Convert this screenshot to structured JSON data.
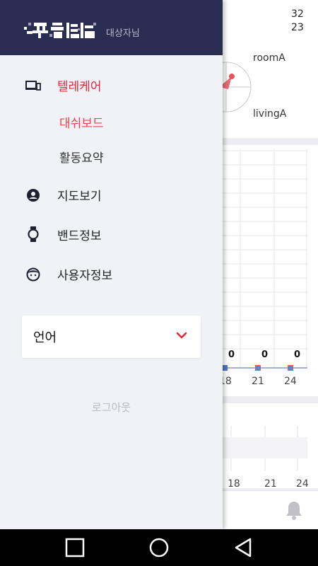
{
  "weather": {
    "icon": "sun-icon",
    "temp_high": "32",
    "temp_low": "23",
    "color": "#f04a2a"
  },
  "rooms": {
    "room_a": "roomA",
    "living_a": "livingA"
  },
  "chart": {
    "values": [
      "0",
      "0",
      "0"
    ],
    "x_labels": [
      "18",
      "21",
      "24"
    ]
  },
  "chart2": {
    "x_labels": [
      "18",
      "21",
      "24"
    ]
  },
  "drawer": {
    "header_bg": "#2a2d52",
    "logo": "logo",
    "user_label": "대상자님",
    "menu": {
      "telecare": {
        "label": "텔레케어",
        "icon": "devices-icon"
      },
      "dashboard": {
        "label": "대쉬보드"
      },
      "activity_summary": {
        "label": "활동요약"
      },
      "map": {
        "label": "지도보기",
        "icon": "person-pin-icon"
      },
      "band": {
        "label": "밴드정보",
        "icon": "watch-icon"
      },
      "user": {
        "label": "사용자정보",
        "icon": "face-icon"
      }
    },
    "language": {
      "label": "언어",
      "icon": "chevron-down-icon"
    },
    "logout": "로그아웃",
    "accent": "#e0283a"
  },
  "navbar": {
    "recent": "square-icon",
    "home": "circle-icon",
    "back": "triangle-icon"
  }
}
